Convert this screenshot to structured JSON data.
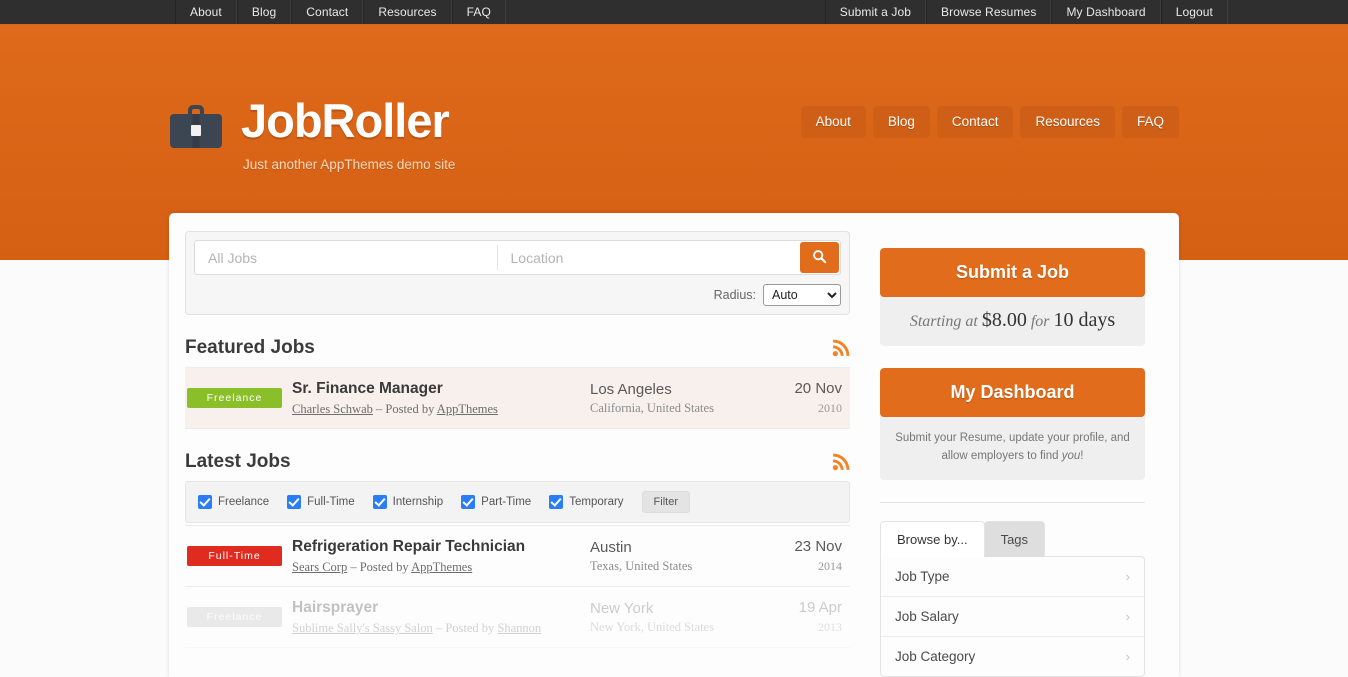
{
  "topbar": {
    "left_items": [
      {
        "label": "About"
      },
      {
        "label": "Blog"
      },
      {
        "label": "Contact"
      },
      {
        "label": "Resources"
      },
      {
        "label": "FAQ"
      }
    ],
    "right_items": [
      {
        "label": "Submit a Job"
      },
      {
        "label": "Browse Resumes"
      },
      {
        "label": "My Dashboard"
      },
      {
        "label": "Logout"
      }
    ]
  },
  "header": {
    "logo_icon": "briefcase-icon",
    "title": "JobRoller",
    "tagline": "Just another AppThemes demo site",
    "nav_items": [
      {
        "label": "About"
      },
      {
        "label": "Blog"
      },
      {
        "label": "Contact"
      },
      {
        "label": "Resources"
      },
      {
        "label": "FAQ"
      }
    ],
    "background_color": "#d9651a"
  },
  "search": {
    "keyword_placeholder": "All Jobs",
    "keyword_value": "",
    "location_placeholder": "Location",
    "location_value": "",
    "search_icon": "magnifier-icon",
    "radius_label": "Radius:",
    "radius_value": "Auto",
    "radius_options": [
      "Auto"
    ]
  },
  "featured": {
    "title": "Featured Jobs",
    "rss_icon": "rss-icon",
    "jobs": [
      {
        "tag": "Freelance",
        "tag_style": "tag-freelance",
        "title": "Sr. Finance Manager",
        "company": "Charles Schwab",
        "posted_sep": " – Posted by ",
        "poster": "AppThemes",
        "city": "Los Angeles",
        "region": "California, United States",
        "day": "20 Nov",
        "year": "2010"
      }
    ]
  },
  "latest": {
    "title": "Latest Jobs",
    "rss_icon": "rss-icon",
    "filters": [
      {
        "label": "Freelance",
        "checked": true
      },
      {
        "label": "Full-Time",
        "checked": true
      },
      {
        "label": "Internship",
        "checked": true
      },
      {
        "label": "Part-Time",
        "checked": true
      },
      {
        "label": "Temporary",
        "checked": true
      }
    ],
    "filter_button": "Filter",
    "jobs": [
      {
        "tag": "Full-Time",
        "tag_style": "tag-fulltime",
        "title": "Refrigeration Repair Technician",
        "company": "Sears Corp",
        "posted_sep": " – Posted by ",
        "poster": "AppThemes",
        "city": "Austin",
        "region": "Texas, United States",
        "day": "23 Nov",
        "year": "2014",
        "expired": false
      },
      {
        "tag": "Freelance",
        "tag_style": "tag-grey",
        "title": "Hairsprayer",
        "company": "Sublime Sally's Sassy Salon",
        "posted_sep": " – Posted by ",
        "poster": "Shannon",
        "city": "New York",
        "region": "New York, United States",
        "day": "19 Apr",
        "year": "2013",
        "expired": true
      }
    ]
  },
  "sidebar": {
    "submit_promo": {
      "button_label": "Submit a Job",
      "sub_prefix": "Starting at ",
      "sub_price": "$8.00",
      "sub_mid": " for ",
      "sub_days": "10 days"
    },
    "dashboard_promo": {
      "button_label": "My Dashboard",
      "note_a": "Submit your Resume, update your profile, and allow employers to find ",
      "note_em": "you",
      "note_b": "!"
    },
    "browse": {
      "tabs": [
        {
          "label": "Browse by...",
          "active": true
        },
        {
          "label": "Tags",
          "active": false
        }
      ],
      "items": [
        {
          "label": "Job Type",
          "chevron": "chevron-right-icon"
        },
        {
          "label": "Job Salary",
          "chevron": "chevron-right-icon"
        },
        {
          "label": "Job Category",
          "chevron": "chevron-right-icon"
        }
      ]
    }
  }
}
